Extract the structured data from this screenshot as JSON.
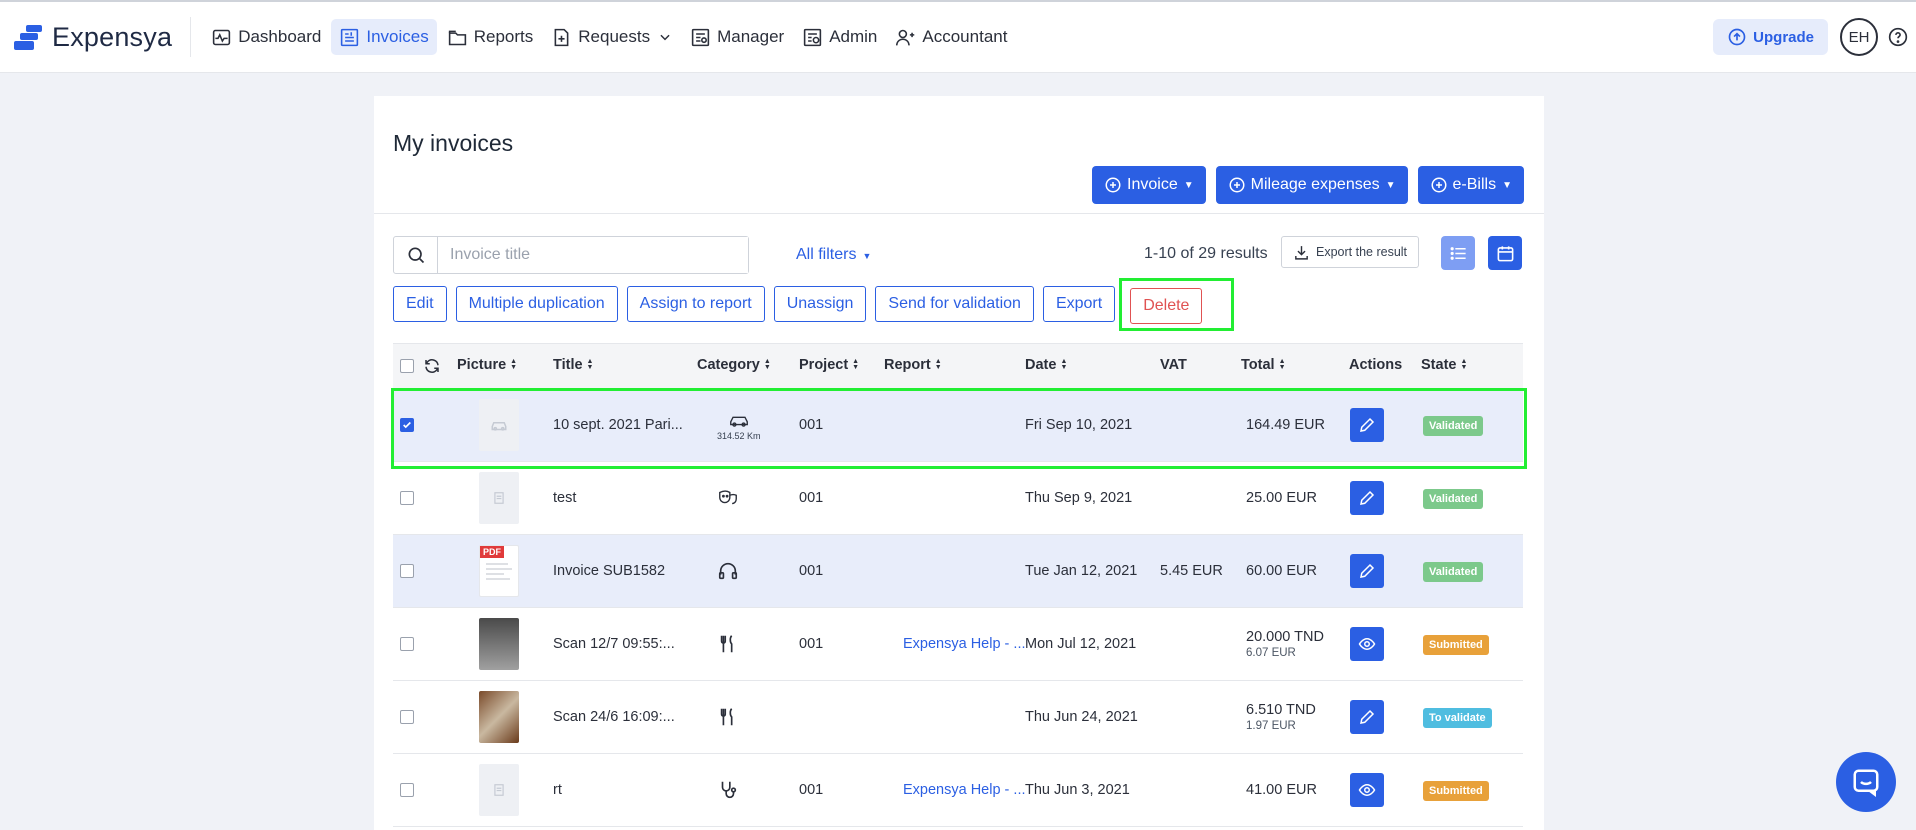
{
  "app": {
    "name": "Expensya"
  },
  "nav": {
    "items": [
      {
        "label": "Dashboard",
        "icon": "dashboard-icon"
      },
      {
        "label": "Invoices",
        "icon": "invoices-icon",
        "active": true
      },
      {
        "label": "Reports",
        "icon": "reports-icon"
      },
      {
        "label": "Requests",
        "icon": "requests-icon"
      },
      {
        "label": "Manager",
        "icon": "manager-icon"
      },
      {
        "label": "Admin",
        "icon": "admin-icon"
      },
      {
        "label": "Accountant",
        "icon": "accountant-icon"
      }
    ],
    "upgrade_label": "Upgrade",
    "avatar_initials": "EH"
  },
  "page": {
    "title": "My invoices"
  },
  "header_buttons": {
    "invoice": "Invoice",
    "mileage": "Mileage expenses",
    "ebills": "e-Bills"
  },
  "toolbar": {
    "search_placeholder": "Invoice title",
    "filters_label": "All filters",
    "results_text": "1-10 of 29 results",
    "export_result_label": "Export the result"
  },
  "actions": {
    "edit": "Edit",
    "multiple_duplication": "Multiple duplication",
    "assign_to_report": "Assign to report",
    "unassign": "Unassign",
    "send_for_validation": "Send for validation",
    "export": "Export",
    "delete": "Delete"
  },
  "table": {
    "columns": {
      "picture": "Picture",
      "title": "Title",
      "category": "Category",
      "project": "Project",
      "report": "Report",
      "date": "Date",
      "vat": "VAT",
      "total": "Total",
      "actions": "Actions",
      "state": "State"
    },
    "rows": [
      {
        "checked": true,
        "title": "10 sept. 2021 Pari...",
        "category_icon": "car-icon",
        "category_sub": "314.52 Km",
        "project": "001",
        "report": "",
        "date": "Fri Sep 10, 2021",
        "vat": "",
        "total": "164.49 EUR",
        "total_sub": "",
        "action": "edit-icon",
        "state": "Validated",
        "state_type": "validated"
      },
      {
        "checked": false,
        "title": "test",
        "category_icon": "theater-icon",
        "category_sub": "",
        "project": "001",
        "report": "",
        "date": "Thu Sep 9, 2021",
        "vat": "",
        "total": "25.00 EUR",
        "total_sub": "",
        "action": "edit-icon",
        "state": "Validated",
        "state_type": "validated"
      },
      {
        "checked": false,
        "title": "Invoice SUB1582",
        "category_icon": "headphones-icon",
        "category_sub": "",
        "project": "001",
        "report": "",
        "date": "Tue Jan 12, 2021",
        "vat": "5.45 EUR",
        "total": "60.00 EUR",
        "total_sub": "",
        "action": "edit-icon",
        "state": "Validated",
        "state_type": "validated"
      },
      {
        "checked": false,
        "title": "Scan 12/7 09:55:...",
        "category_icon": "restaurant-icon",
        "category_sub": "",
        "project": "001",
        "report": "Expensya Help - ...",
        "date": "Mon Jul 12, 2021",
        "vat": "",
        "total": "20.000 TND",
        "total_sub": "6.07 EUR",
        "action": "view-icon",
        "state": "Submitted",
        "state_type": "submitted"
      },
      {
        "checked": false,
        "title": "Scan 24/6 16:09:...",
        "category_icon": "restaurant-icon",
        "category_sub": "",
        "project": "",
        "report": "",
        "date": "Thu Jun 24, 2021",
        "vat": "",
        "total": "6.510 TND",
        "total_sub": "1.97 EUR",
        "action": "edit-icon",
        "state": "To validate",
        "state_type": "tovalidate"
      },
      {
        "checked": false,
        "title": "rt",
        "category_icon": "stethoscope-icon",
        "category_sub": "",
        "project": "001",
        "report": "Expensya Help - ...",
        "date": "Thu Jun 3, 2021",
        "vat": "",
        "total": "41.00 EUR",
        "total_sub": "",
        "action": "view-icon",
        "state": "Submitted",
        "state_type": "submitted"
      }
    ]
  },
  "colors": {
    "primary": "#2b5fe3",
    "validated": "#7cc98b",
    "submitted": "#e8a13a",
    "to_validate": "#4fbde0",
    "delete": "#e05252",
    "highlight": "#22ee33"
  }
}
